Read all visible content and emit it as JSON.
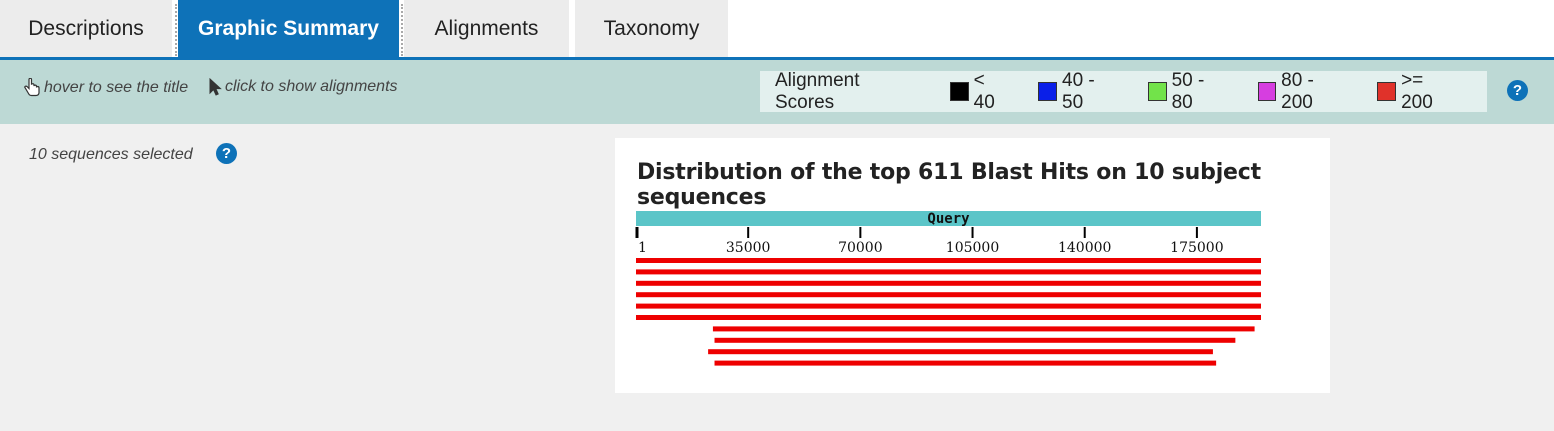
{
  "tabs": [
    {
      "label": "Descriptions",
      "active": false
    },
    {
      "label": "Graphic Summary",
      "active": true
    },
    {
      "label": "Alignments",
      "active": false
    },
    {
      "label": "Taxonomy",
      "active": false
    }
  ],
  "hints": {
    "hover": "hover to see the title",
    "click": "click to show alignments"
  },
  "legend": {
    "title": "Alignment Scores",
    "items": [
      {
        "label": "< 40",
        "color": "#000000"
      },
      {
        "label": "40 - 50",
        "color": "#0a1fe8"
      },
      {
        "label": "50 - 80",
        "color": "#72e34a"
      },
      {
        "label": "80 - 200",
        "color": "#d63ee0"
      },
      {
        "label": ">= 200",
        "color": "#e0322a"
      }
    ]
  },
  "help_glyph": "?",
  "selection": {
    "text": "10 sequences selected"
  },
  "chart_data": {
    "type": "alignment-overview",
    "title": "Distribution of the top 611 Blast Hits on 10 subject sequences",
    "query_label": "Query",
    "query_range": [
      1,
      195000
    ],
    "ticks": [
      1,
      35000,
      70000,
      105000,
      140000,
      175000
    ],
    "hit_color": "#ee0000",
    "hits": [
      {
        "start": 1,
        "end": 195000
      },
      {
        "start": 1,
        "end": 195000
      },
      {
        "start": 1,
        "end": 195000
      },
      {
        "start": 1,
        "end": 195000
      },
      {
        "start": 1,
        "end": 195000
      },
      {
        "start": 1,
        "end": 195000
      },
      {
        "start": 24000,
        "end": 193000
      },
      {
        "start": 24500,
        "end": 187000
      },
      {
        "start": 22500,
        "end": 180000
      },
      {
        "start": 24500,
        "end": 181000
      }
    ]
  }
}
